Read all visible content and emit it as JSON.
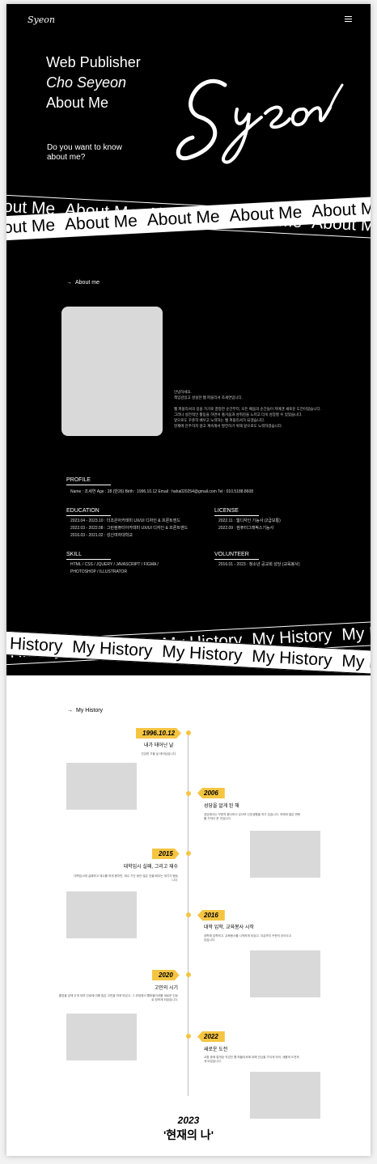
{
  "header": {
    "logo": "Syeon",
    "menu_icon": "hamburger-menu-icon"
  },
  "hero": {
    "line1": "Web Publisher",
    "line2": "Cho Seyeon",
    "line3": "About Me",
    "question_line1": "Do you want to know",
    "question_line2": "about me?",
    "signature": "Syeon"
  },
  "band_about": {
    "text": "About Me"
  },
  "about": {
    "label": "About me",
    "intro": [
      "안녕하세요.",
      "책임감있고 성실한 웹 퍼블리셔 조세연입니다.",
      "",
      "웹 퍼블리셔의 길을 가기로 결정한 순간부터, 모든 배움의 순간들이 저에겐 새로운 도전이었습니다.",
      "그러나 실전적인 활동을 하면서 즐거움과 성취감을 느끼고 더욱 성장할 수 있었습니다.",
      "앞으로도 꾸준히 배우고 노력하는 웹 퍼블리셔가 되겠습니다.",
      "현재에 안주하지 않고 계속해서 발전하기 위해 앞으로도 노력하겠습니다."
    ],
    "profile": {
      "title": "PROFILE",
      "line": "Name : 조세연     Age : 28 (만26)     Birth : 1996.10.12     Email : haha020254@gmail.com     Tel : 010.5188.8608"
    },
    "education": {
      "title": "EDUCATION",
      "items": [
        "2023.04 - 2023.10 : 더조은아카데미 UX/UI 디자인 & 프론트엔드",
        "2022.03 - 2022.08 : 그린컴퓨터아카데미 UX/UI 디자인 & 프론트엔드",
        "2016.03 - 2021.02 : 성신여자대학교"
      ]
    },
    "license": {
      "title": "LICENSE",
      "items": [
        "2022.11 : 웹디자인 기능사 (2급보통)",
        "2022.09 : 컴퓨터그래픽스기능사"
      ]
    },
    "skill": {
      "title": "SKILL",
      "items": [
        "HTML / CSS / JQUERY / JAVASCRIPT  / FIGMA /",
        "PHOTOSHOP / ILLUSTRATOR"
      ]
    },
    "volunteer": {
      "title": "VOLUNTEER",
      "items": [
        "2016.01 - 2023 : 청소년 공교회 성당 (교육봉사)"
      ]
    }
  },
  "band_history": {
    "text": "My History"
  },
  "history": {
    "label": "My History",
    "events": [
      {
        "year": "1996.10.12",
        "title": "내가 태어난 날",
        "text": "건강한 가을 날 태어났습니다."
      },
      {
        "year": "2006",
        "title": "성당을 알게 된 해",
        "text": "성당에서는 꾸준히 봉사하고 있으며 신앙생활을 하고 있습니다. 저에게 많은 변화를 가져다 준 곳입니다."
      },
      {
        "year": "2015",
        "title": "대학입시 실패, 그리고 재수",
        "text": "대학입시에 실패하고 재수를 하게 됐지만, 재수 기간 동안 많은 것을 배우는 계기가 됐습니다."
      },
      {
        "year": "2016",
        "title": "대학 입학, 교육봉사 시작",
        "text": "대학에 입학하고, 교육봉사를 시작하게 되었고, 지금까지 꾸준히 이어오고 있습니다."
      },
      {
        "year": "2020",
        "title": "고민의 시기",
        "text": "졸업을 앞에 두게 되며 진로에 대해 많은 고민을 하게 되었고, 그 과정에서 웹퍼블리셔를 새로운 진로로 정하게 되었습니다."
      },
      {
        "year": "2022",
        "title": "새로운 도전",
        "text": "교환 중에 알게된 직업인 웹 퍼블리셔에 대해 관심을 가지게 되어, 새롭게 도전하게 되었습니다."
      }
    ],
    "final_year": "2023",
    "final_title": "'현재의 나'"
  },
  "colors": {
    "accent": "#f5c542",
    "background": "#000000",
    "history_bg": "#ffffff"
  }
}
